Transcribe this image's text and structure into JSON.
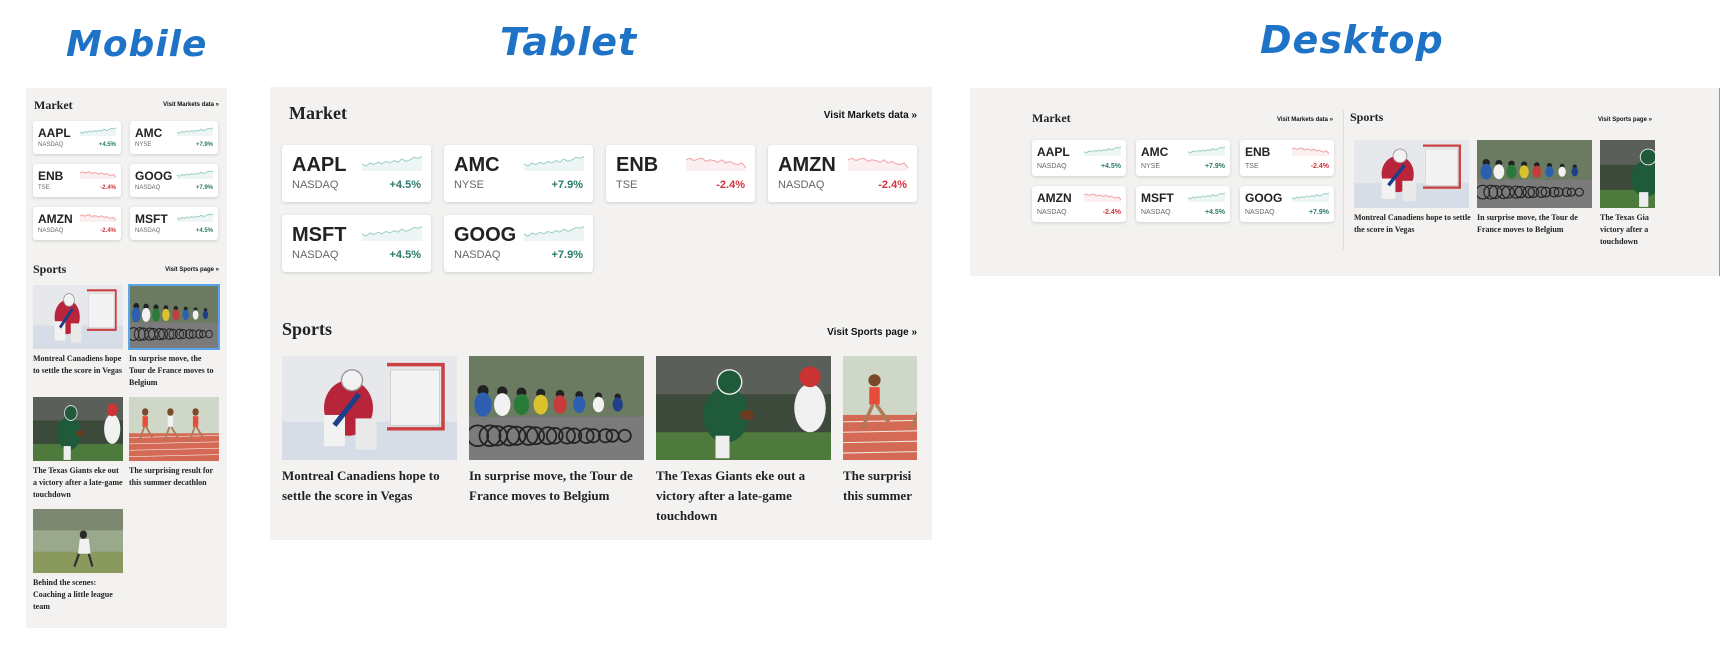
{
  "labels": {
    "mobile": "Mobile",
    "tablet": "Tablet",
    "desktop": "Desktop"
  },
  "market": {
    "title": "Market",
    "link": "Visit Markets data »"
  },
  "sports": {
    "title": "Sports",
    "link": "Visit Sports page »"
  },
  "stocks": {
    "aapl": {
      "symbol": "AAPL",
      "exchange": "NASDAQ",
      "change": "+4.5%",
      "trend": "up"
    },
    "amc": {
      "symbol": "AMC",
      "exchange": "NYSE",
      "change": "+7.9%",
      "trend": "up"
    },
    "enb": {
      "symbol": "ENB",
      "exchange": "TSE",
      "change": "-2.4%",
      "trend": "down"
    },
    "amzn": {
      "symbol": "AMZN",
      "exchange": "NASDAQ",
      "change": "-2.4%",
      "trend": "down"
    },
    "msft": {
      "symbol": "MSFT",
      "exchange": "NASDAQ",
      "change": "+4.5%",
      "trend": "up"
    },
    "goog": {
      "symbol": "GOOG",
      "exchange": "NASDAQ",
      "change": "+7.9%",
      "trend": "up"
    }
  },
  "stories": {
    "s1": {
      "caption": "Montreal Canadiens hope to settle the score in Vegas",
      "image": "hockey-goalie-photo"
    },
    "s2": {
      "caption": "In surprise move, the Tour de France moves to Belgium",
      "image": "cycling-peloton-photo"
    },
    "s3": {
      "caption": "The Texas Giants eke out a victory after a late-game touchdown",
      "image": "football-runner-photo"
    },
    "s4": {
      "caption": "The surprising result for this summer decathlon",
      "image": "track-runners-photo"
    },
    "s5": {
      "caption": "Behind the scenes: Coaching a little league team",
      "image": "little-league-photo"
    }
  },
  "truncated": {
    "desktop_s3": "The Texas Gia victory after a touchdown",
    "tablet_s4": "The surprisi this summer"
  },
  "colors": {
    "up": "#2a7a6a",
    "down": "#d6323a",
    "spark_up": "#9ccfc6",
    "spark_down": "#f0a4a8",
    "accent": "#1f73c7"
  }
}
